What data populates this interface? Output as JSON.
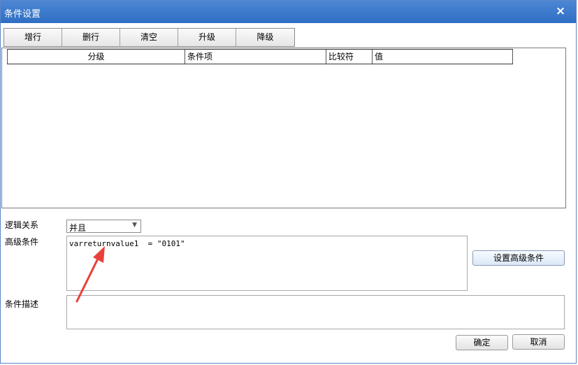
{
  "dialog": {
    "title": "条件设置",
    "close_symbol": "×"
  },
  "toolbar": {
    "buttons": [
      "增行",
      "删行",
      "清空",
      "升级",
      "降级"
    ]
  },
  "grid": {
    "columns": [
      "分级",
      "条件项",
      "比较符",
      "值"
    ]
  },
  "form": {
    "logic_label": "逻辑关系",
    "logic_value": "并且",
    "advanced_label": "高级条件",
    "advanced_value": "varreturnvalue1  = \"0101\"",
    "set_advanced_button": "设置高级条件",
    "desc_label": "条件描述",
    "desc_value": ""
  },
  "footer": {
    "ok": "确定",
    "cancel": "取消"
  },
  "annotation": {
    "arrow_color": "#e8413a"
  }
}
